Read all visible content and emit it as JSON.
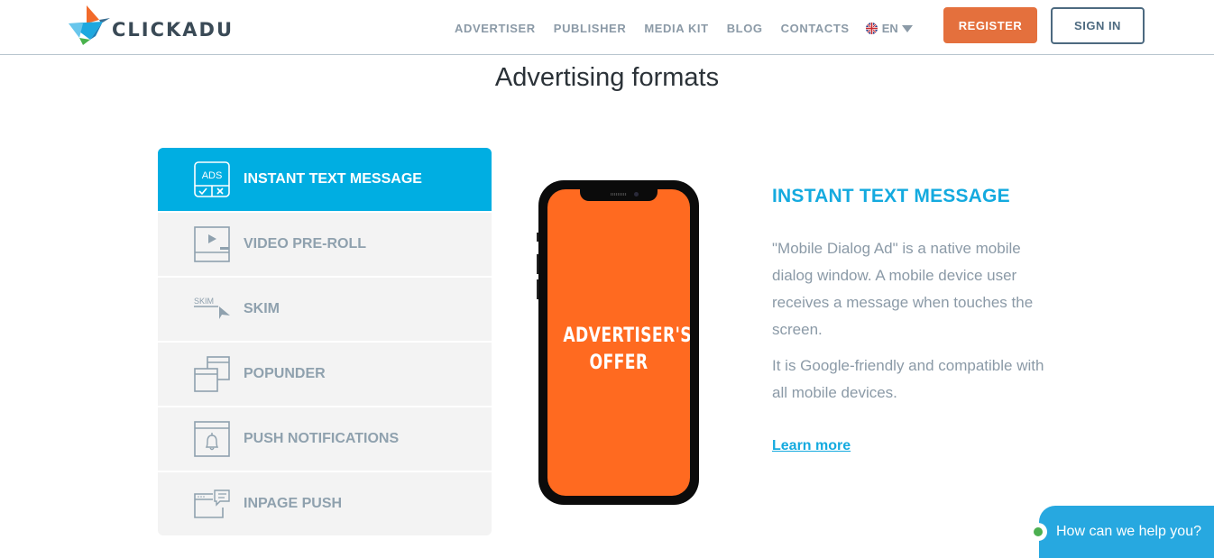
{
  "brand": {
    "name": "CLICKADU",
    "colors": {
      "orange": "#ff6a20",
      "blue": "#14aadf",
      "green": "#4caf50",
      "register": "#e4703d"
    }
  },
  "nav": {
    "items": [
      {
        "label": "ADVERTISER"
      },
      {
        "label": "PUBLISHER"
      },
      {
        "label": "MEDIA KIT"
      },
      {
        "label": "BLOG"
      },
      {
        "label": "CONTACTS"
      }
    ],
    "language": {
      "icon": "uk-flag-icon",
      "selected": "EN"
    },
    "register_label": "REGISTER",
    "signin_label": "SIGN IN"
  },
  "main": {
    "title": "Advertising formats",
    "formats": [
      {
        "label": "INSTANT TEXT MESSAGE",
        "icon": "ads-message-icon",
        "active": true
      },
      {
        "label": "VIDEO PRE-ROLL",
        "icon": "video-player-icon",
        "active": false
      },
      {
        "label": "SKIM",
        "icon": "skim-cursor-icon",
        "icon_text": "SKIM",
        "active": false
      },
      {
        "label": "POPUNDER",
        "icon": "stacked-windows-icon",
        "active": false
      },
      {
        "label": "PUSH NOTIFICATIONS",
        "icon": "bell-window-icon",
        "active": false
      },
      {
        "label": "INPAGE PUSH",
        "icon": "browser-chat-icon",
        "active": false
      }
    ],
    "ads_icon_text": "ADS",
    "phone_screen_text": [
      "ADVERTISER'S",
      "OFFER"
    ],
    "detail": {
      "title": "INSTANT TEXT MESSAGE",
      "paragraph1": "\"Mobile Dialog Ad\" is a native mobile dialog window. A mobile device user receives a message when touches the screen.",
      "paragraph2": "It is Google-friendly and compatible with all mobile devices.",
      "link_label": "Learn more"
    }
  },
  "chat": {
    "label": "How can we help you?",
    "status": "online"
  }
}
